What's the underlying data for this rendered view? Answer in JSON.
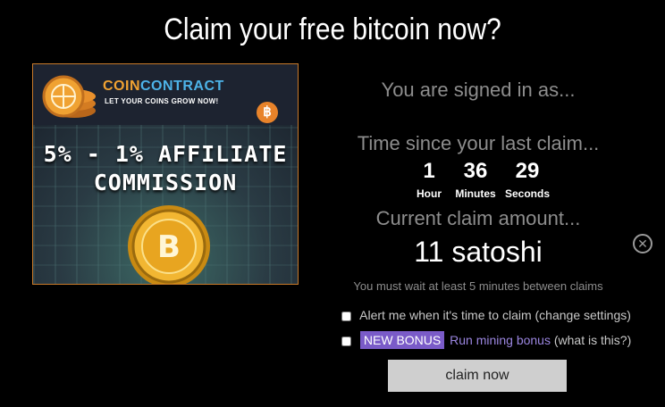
{
  "page": {
    "title": "Claim your free bitcoin now?"
  },
  "ad": {
    "brand_coin": "COIN",
    "brand_contract": "CONTRACT",
    "tagline": "LET YOUR COINS GROW NOW!",
    "badge_symbol": "฿",
    "headline_line1": "5% - 1% AFFILIATE",
    "headline_line2": "COMMISSION",
    "accent_color": "#f0a232"
  },
  "status": {
    "signed_in": "You are signed in as...",
    "time_since_label": "Time since your last claim...",
    "countdown": [
      {
        "value": "1",
        "unit": "Hour"
      },
      {
        "value": "36",
        "unit": "Minutes"
      },
      {
        "value": "29",
        "unit": "Seconds"
      }
    ],
    "claim_label": "Current claim amount...",
    "claim_amount": "11 satoshi",
    "wait_note": "You must wait at least 5 minutes between claims"
  },
  "options": {
    "alert_label": "Alert me when it's time to claim (change settings)",
    "bonus_badge": "NEW BONUS",
    "bonus_link": "Run mining bonus",
    "bonus_help": "(what is this?)"
  },
  "actions": {
    "claim_button": "claim now",
    "close_icon": "close-circle-icon"
  }
}
